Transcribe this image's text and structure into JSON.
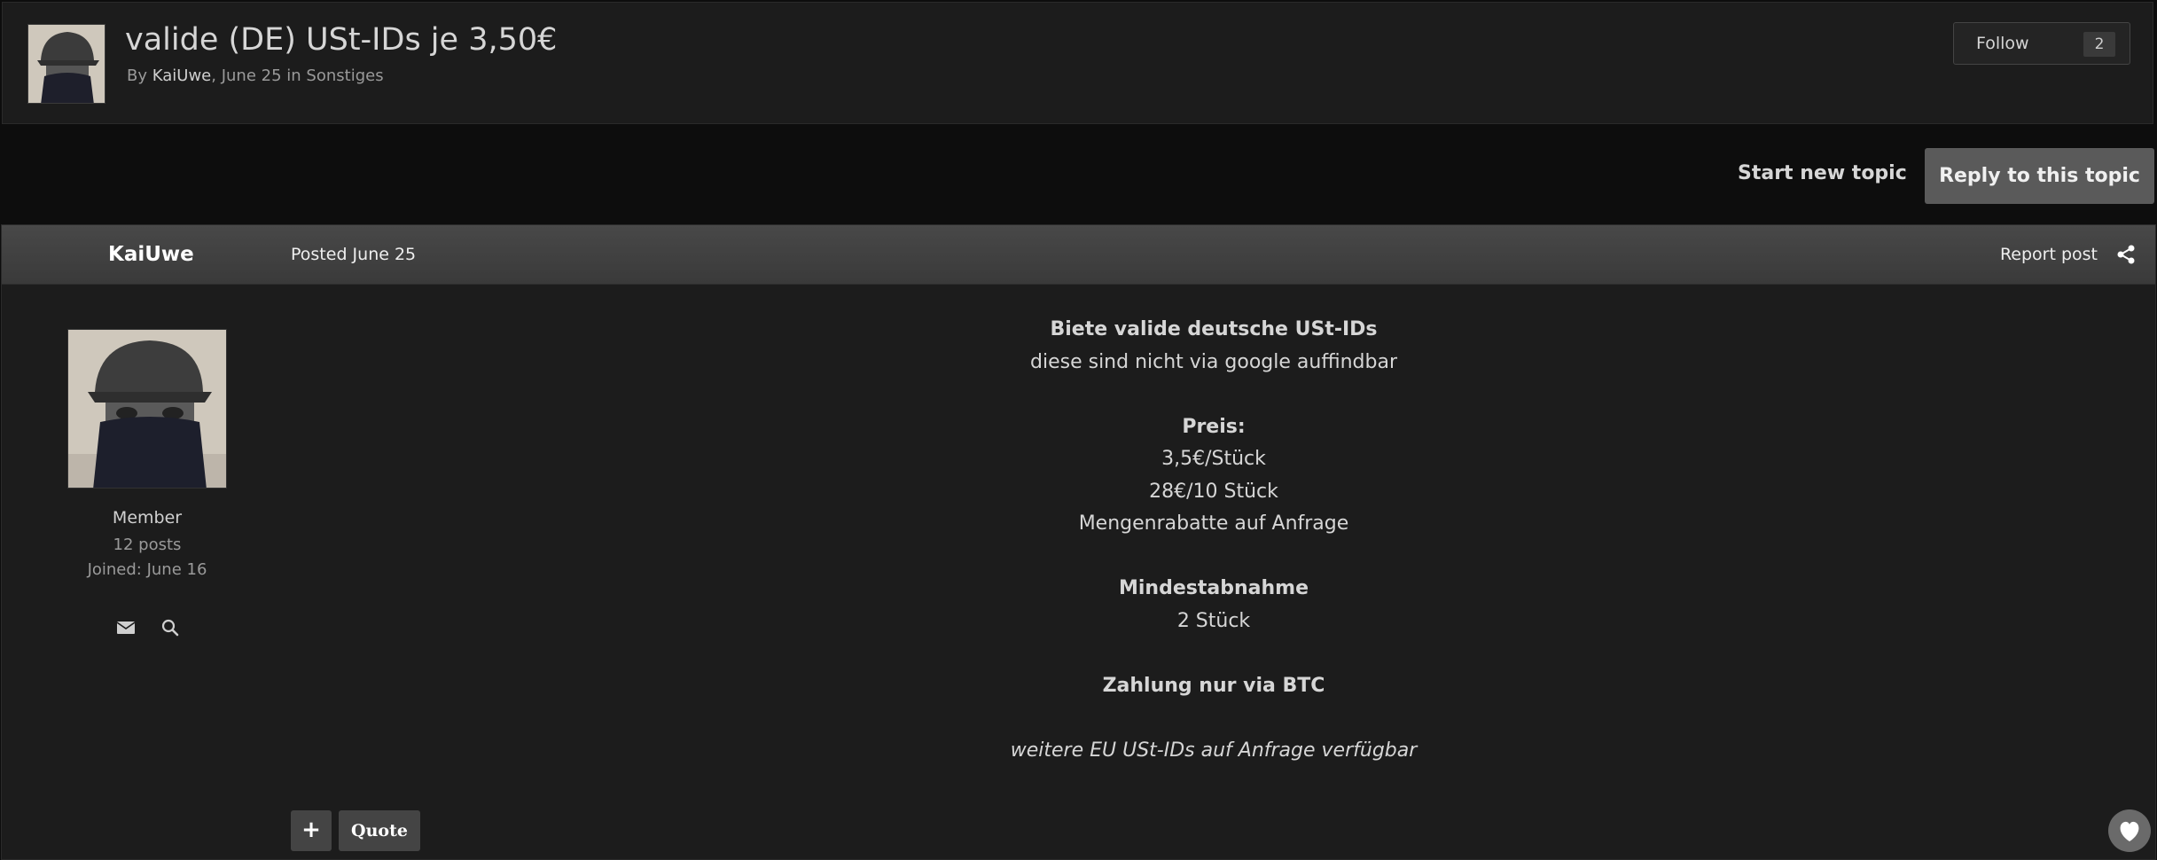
{
  "topic": {
    "title": "valide (DE) USt-IDs je 3,50€",
    "by_prefix": "By",
    "author": "KaiUwe",
    "date": ", June 25",
    "in_prefix": " in",
    "forum": "Sonstiges"
  },
  "follow": {
    "label": "Follow",
    "count": "2"
  },
  "actions": {
    "start_new_topic": "Start new topic",
    "reply": "Reply to this topic"
  },
  "post": {
    "author": "KaiUwe",
    "posted": "Posted June 25",
    "report": "Report post",
    "user": {
      "role": "Member",
      "posts": "12 posts",
      "joined": "Joined: June 16"
    },
    "content": {
      "heading": "Biete valide deutsche USt-IDs",
      "subheading": "diese sind nicht via google auffindbar",
      "price_label": "Preis:",
      "price_1": "3,5€/Stück",
      "price_2": "28€/10 Stück",
      "price_3": "Mengenrabatte auf Anfrage",
      "min_label": "Mindestabnahme",
      "min_value": "2 Stück",
      "payment": "Zahlung nur via BTC",
      "footer": "weitere EU USt-IDs auf Anfrage verfügbar"
    },
    "buttons": {
      "plus": "+",
      "quote": "Quote"
    }
  },
  "icons": {
    "share": "share-icon",
    "envelope": "envelope-icon",
    "search": "search-icon",
    "heart": "heart-icon"
  },
  "colors": {
    "background": "#0d0d0d",
    "panel": "#1c1c1c",
    "header": "#444444",
    "reply_button": "#5a5a5a"
  }
}
